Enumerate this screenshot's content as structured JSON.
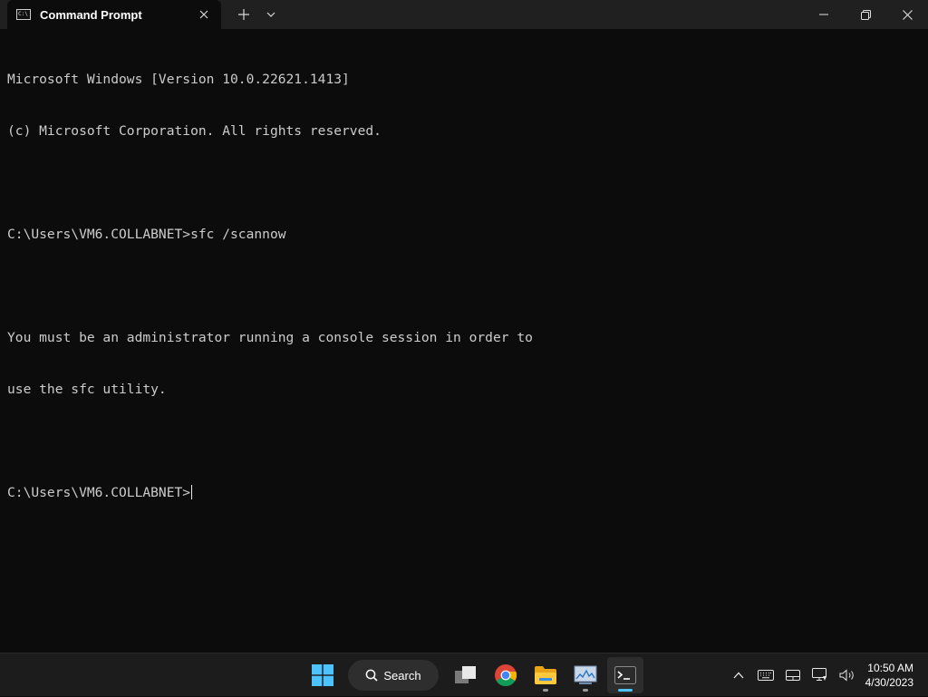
{
  "window": {
    "tab_title": "Command Prompt",
    "tab_icon": "cmd-icon",
    "new_tab_label": "+",
    "controls": [
      "minimize",
      "maximize",
      "close"
    ]
  },
  "console": {
    "lines": [
      "Microsoft Windows [Version 10.0.22621.1413]",
      "(c) Microsoft Corporation. All rights reserved.",
      "",
      "C:\\Users\\VM6.COLLABNET>sfc /scannow",
      "",
      "You must be an administrator running a console session in order to",
      "use the sfc utility.",
      "",
      "C:\\Users\\VM6.COLLABNET>"
    ]
  },
  "taskbar": {
    "search_label": "Search",
    "apps": [
      {
        "name": "task-view",
        "running": false
      },
      {
        "name": "chrome",
        "running": false
      },
      {
        "name": "file-explorer",
        "running": true
      },
      {
        "name": "task-manager",
        "running": true
      },
      {
        "name": "terminal",
        "running": true,
        "active": true
      }
    ],
    "clock": {
      "time": "10:50 AM",
      "date": "4/30/2023"
    }
  },
  "colors": {
    "console_bg": "#0c0c0c",
    "console_fg": "#cccccc",
    "titlebar_bg": "#202020",
    "taskbar_bg": "#1c1c1c",
    "accent": "#4cc2ff"
  }
}
